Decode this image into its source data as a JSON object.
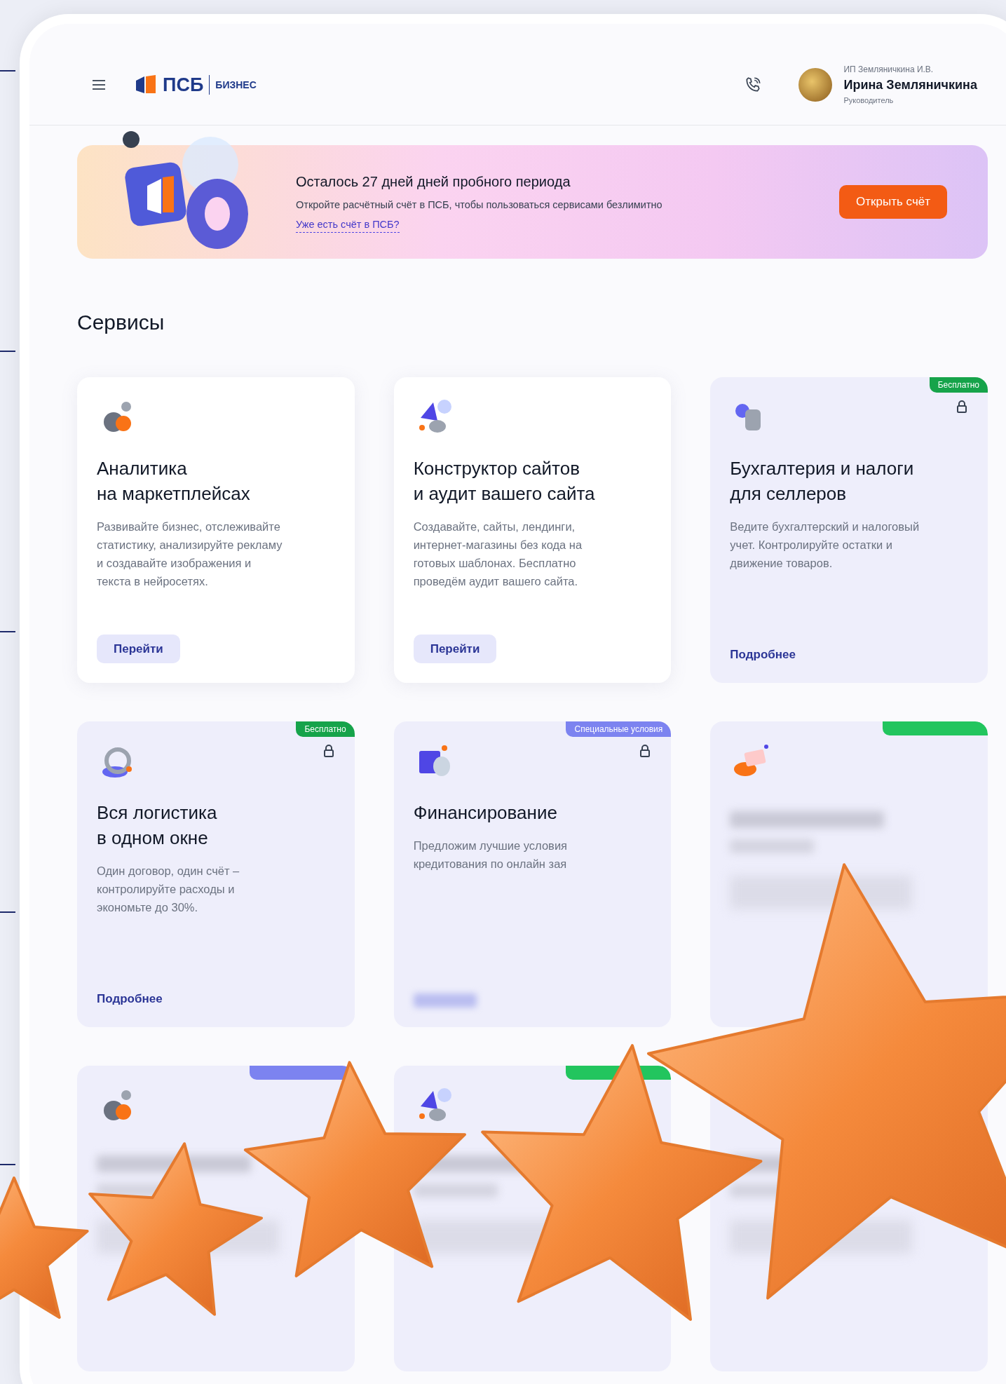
{
  "header": {
    "logo": {
      "brand": "ПСБ",
      "product": "БИЗНЕС"
    },
    "user": {
      "company": "ИП Земляничкина И.В.",
      "name": "Ирина Земляничкина",
      "role": "Руководитель"
    }
  },
  "banner": {
    "title": "Осталось 27 дней дней пробного периода",
    "text": "Откройте расчётный счёт в ПСБ, чтобы пользоваться сервисами безлимитно",
    "link": "Уже есть счёт в ПСБ?",
    "button": "Открыть счёт"
  },
  "section_title": "Сервисы",
  "cards": [
    {
      "kind": "service",
      "locked": false,
      "title": [
        "Аналитика",
        "на маркетплейсах"
      ],
      "description": "Развивайте бизнес, отслеживайте статистику, анализируйте рекламу и создавайте изображения и текста в нейросетях.",
      "action": {
        "kind": "button",
        "text": "Перейти"
      }
    },
    {
      "kind": "service",
      "locked": false,
      "title": [
        "Конструктор сайтов",
        "и аудит вашего сайта"
      ],
      "description": "Создавайте, сайты, лендинги, интернет-магазины без кода на готовых шаблонах. Бесплатно проведём аудит вашего сайта.",
      "action": {
        "kind": "button",
        "text": "Перейти"
      }
    },
    {
      "kind": "service",
      "locked": true,
      "badge": {
        "text": "Бесплатно",
        "color": "#16a34a"
      },
      "title": [
        "Бухгалтерия и налоги",
        "для селлеров"
      ],
      "description": "Ведите бухгалтерский и налоговый учет. Контролируйте остатки и движение товаров.",
      "action": {
        "kind": "link",
        "text": "Подробнее"
      }
    },
    {
      "kind": "service",
      "locked": true,
      "badge": {
        "text": "Бесплатно",
        "color": "#16a34a"
      },
      "title": [
        "Вся логистика",
        "в одном окне"
      ],
      "description": "Один договор, один счёт – контролируйте расходы и экономьте до 30%.",
      "action": {
        "kind": "link",
        "text": "Подробнее"
      }
    },
    {
      "kind": "service",
      "locked": true,
      "badge": {
        "text": "Специальные условия",
        "color": "#7c83f0"
      },
      "title": [
        "Финансирование"
      ],
      "description": "Предложим лучшие условия кредитования по онлайн зая"
    },
    {
      "kind": "obscured",
      "badge": {
        "color": "#22c55e"
      }
    },
    {
      "kind": "obscured",
      "badge": {
        "color": "#7c83f0"
      }
    },
    {
      "kind": "obscured",
      "badge": {
        "color": "#22c55e"
      }
    },
    {
      "kind": "obscured"
    }
  ]
}
